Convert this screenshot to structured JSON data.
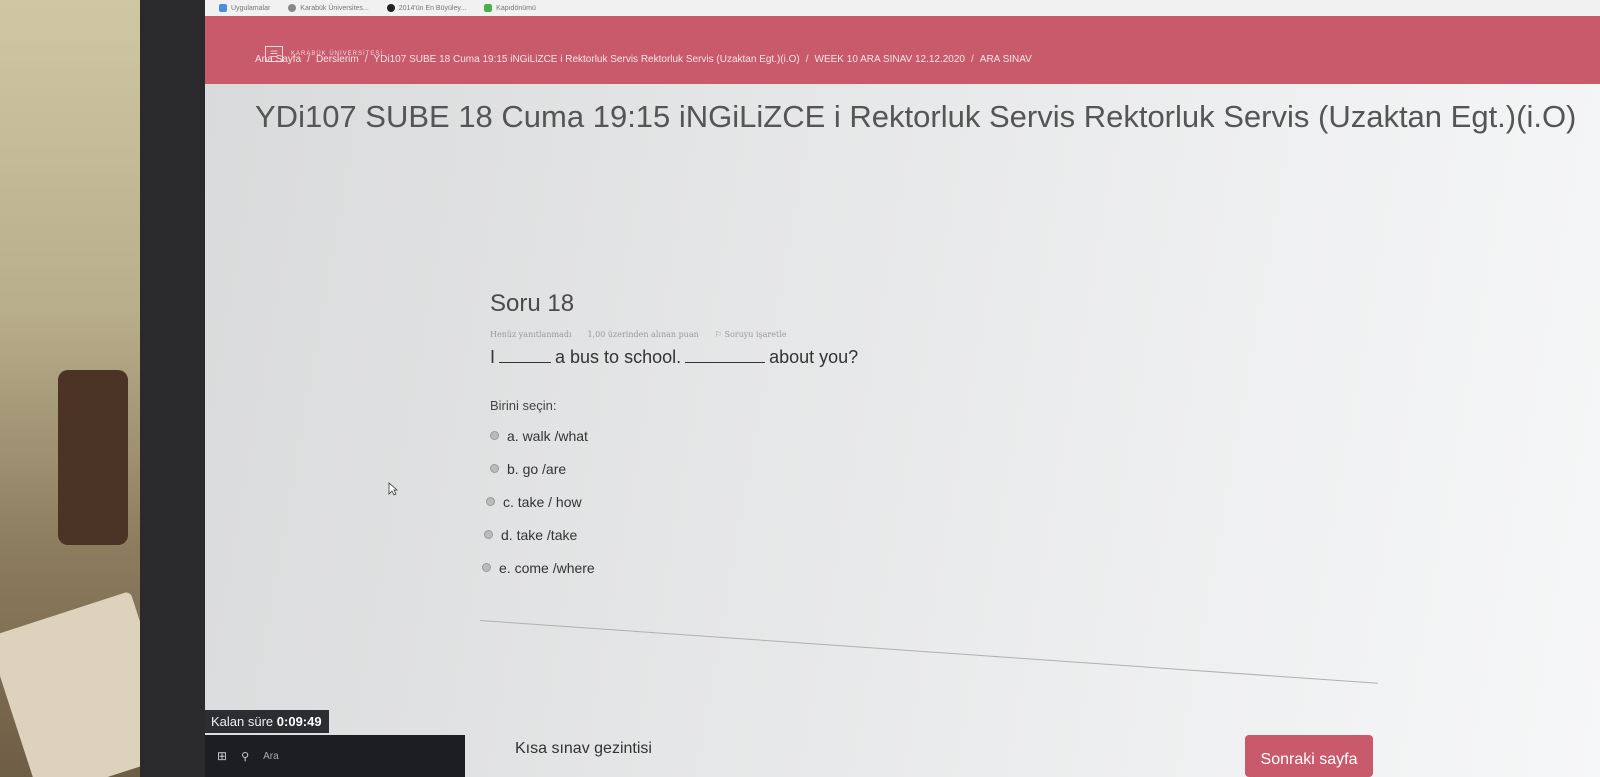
{
  "bookmarks": [
    {
      "label": "Uygulamalar",
      "icon": "apps-grid-icon",
      "color": "#4a90d9"
    },
    {
      "label": "Karabük Üniversites...",
      "icon": "globe-icon",
      "color": "#888888"
    },
    {
      "label": "2014'ün En Büyüley...",
      "icon": "page-icon",
      "color": "#222222"
    },
    {
      "label": "Kapıdönümü",
      "icon": "leaf-icon",
      "color": "#4caf50"
    }
  ],
  "brand": {
    "logo_text": "KARABÜK ÜNİVERSİTESİ",
    "accent": "#c85a6c"
  },
  "breadcrumb": [
    "Ana Sayfa",
    "Derslerim",
    "YDi107 SUBE 18 Cuma 19:15 iNGiLiZCE i Rektorluk Servis Rektorluk Servis (Uzaktan Egt.)(i.O)",
    "WEEK 10 ARA SINAV 12.12.2020",
    "ARA SINAV"
  ],
  "course_title": "YDi107 SUBE 18 Cuma 19:15 iNGiLiZCE i Rektorluk Servis Rektorluk Servis (Uzaktan Egt.)(i.O)",
  "question": {
    "number_label": "Soru 18",
    "status": "Henüz yanıtlanmadı",
    "points": "1,00 üzerinden alınan puan",
    "flag_label": "Soruyu işaretle",
    "text_part1": "I",
    "text_part2": "a bus to school.",
    "text_part3": "about you?",
    "choose_label": "Birini seçin:",
    "options": [
      "a. walk /what",
      "b. go /are",
      "c. take / how",
      "d. take /take",
      "e. come /where"
    ]
  },
  "timer": {
    "label": "Kalan süre",
    "value": "0:09:49"
  },
  "taskbar": {
    "search_label": "Ara"
  },
  "footer": {
    "nav_link": "Kısa sınav gezintisi",
    "next_button": "Sonraki sayfa"
  }
}
